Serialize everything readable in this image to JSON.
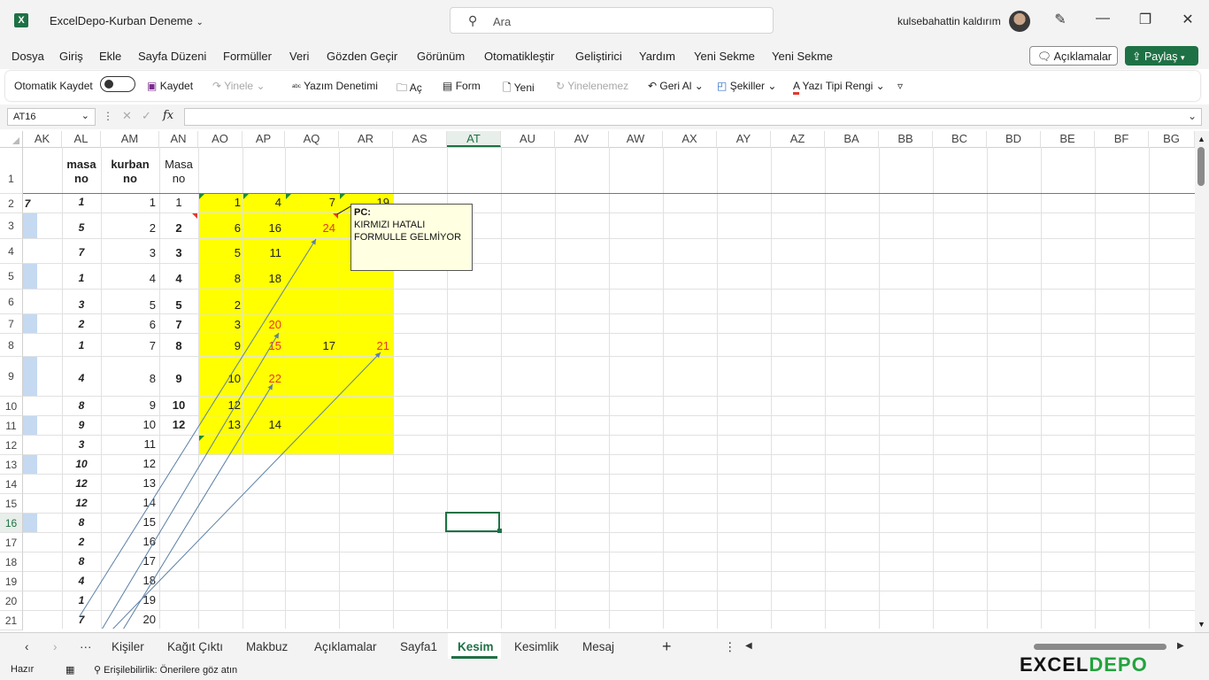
{
  "titlebar": {
    "file_name": "ExcelDepo-Kurban Deneme",
    "search_placeholder": "Ara",
    "user_name": "kulsebahattin kaldırım",
    "minimize": "—",
    "restore": "❐",
    "close": "✕"
  },
  "menu": {
    "items": [
      "Dosya",
      "Giriş",
      "Ekle",
      "Sayfa Düzeni",
      "Formüller",
      "Veri",
      "Gözden Geçir",
      "Görünüm",
      "Otomatikleştir",
      "Geliştirici",
      "Yardım",
      "Yeni Sekme",
      "Yeni Sekme"
    ],
    "comments_label": "Açıklamalar",
    "share_label": "Paylaş"
  },
  "toolbar": {
    "autosave": "Otomatik Kaydet",
    "save": "Kaydet",
    "redo": "Yinele",
    "spelling": "Yazım Denetimi",
    "open": "Aç",
    "form": "Form",
    "new": "Yeni",
    "cannot_repeat": "Yinelenemez",
    "undo": "Geri Al",
    "shapes": "Şekiller",
    "font_color": "Yazı Tipi Rengi"
  },
  "formula_bar": {
    "name_box": "AT16",
    "fx": "fx",
    "formula": ""
  },
  "columns": [
    "AK",
    "AL",
    "AM",
    "AN",
    "AO",
    "AP",
    "AQ",
    "AR",
    "AS",
    "AT",
    "AU",
    "AV",
    "AW",
    "AX",
    "AY",
    "AZ",
    "BA",
    "BB",
    "BC",
    "BD",
    "BE",
    "BF",
    "BG"
  ],
  "rows": [
    "1",
    "2",
    "3",
    "4",
    "5",
    "6",
    "7",
    "8",
    "9",
    "10",
    "11",
    "12",
    "13",
    "14",
    "15",
    "16",
    "17",
    "18",
    "19",
    "20",
    "21"
  ],
  "headers": {
    "al_1": "masa",
    "al_2": "no",
    "am_1": "kurban",
    "am_2": "no",
    "an_1": "Masa",
    "an_2": "no"
  },
  "col_al": [
    "1",
    "5",
    "7",
    "1",
    "3",
    "2",
    "1",
    "4",
    "8",
    "9",
    "3",
    "10",
    "12",
    "12",
    "8",
    "2",
    "8",
    "4",
    "1",
    "7"
  ],
  "col_am": [
    "1",
    "2",
    "3",
    "4",
    "5",
    "6",
    "7",
    "8",
    "9",
    "10",
    "11",
    "12",
    "13",
    "14",
    "15",
    "16",
    "17",
    "18",
    "19",
    "20"
  ],
  "col_an": [
    "1",
    "2",
    "3",
    "4",
    "5",
    "7",
    "8",
    "9",
    "10",
    "12"
  ],
  "col_ao": [
    "1",
    "6",
    "5",
    "8",
    "2",
    "3",
    "9",
    "10",
    "12",
    "13"
  ],
  "col_ap": [
    "4",
    "16",
    "11",
    "18",
    "20",
    "15",
    "22",
    "14"
  ],
  "col_aq": [
    "7",
    "24",
    "17"
  ],
  "col_ar": [
    "19",
    "21"
  ],
  "comment": {
    "author": "PC:",
    "line1": "KIRMIZI  HATALI",
    "line2": "FORMULLE GELMİYOR"
  },
  "sheets": [
    "Kişiler",
    "Kağıt Çıktı",
    "Makbuz",
    "Açıklamalar",
    "Sayfa1",
    "Kesim",
    "Kesimlik",
    "Mesaj"
  ],
  "active_sheet": "Kesim",
  "status": {
    "ready": "Hazır",
    "accessibility": "Erişilebilirlik: Önerilere göz atın"
  },
  "watermark": {
    "part1": "EXCEL",
    "part2": "DEPO"
  },
  "colors": {
    "accent": "#1e7145",
    "highlight": "#ffff00",
    "error_text": "#e03a2e"
  }
}
